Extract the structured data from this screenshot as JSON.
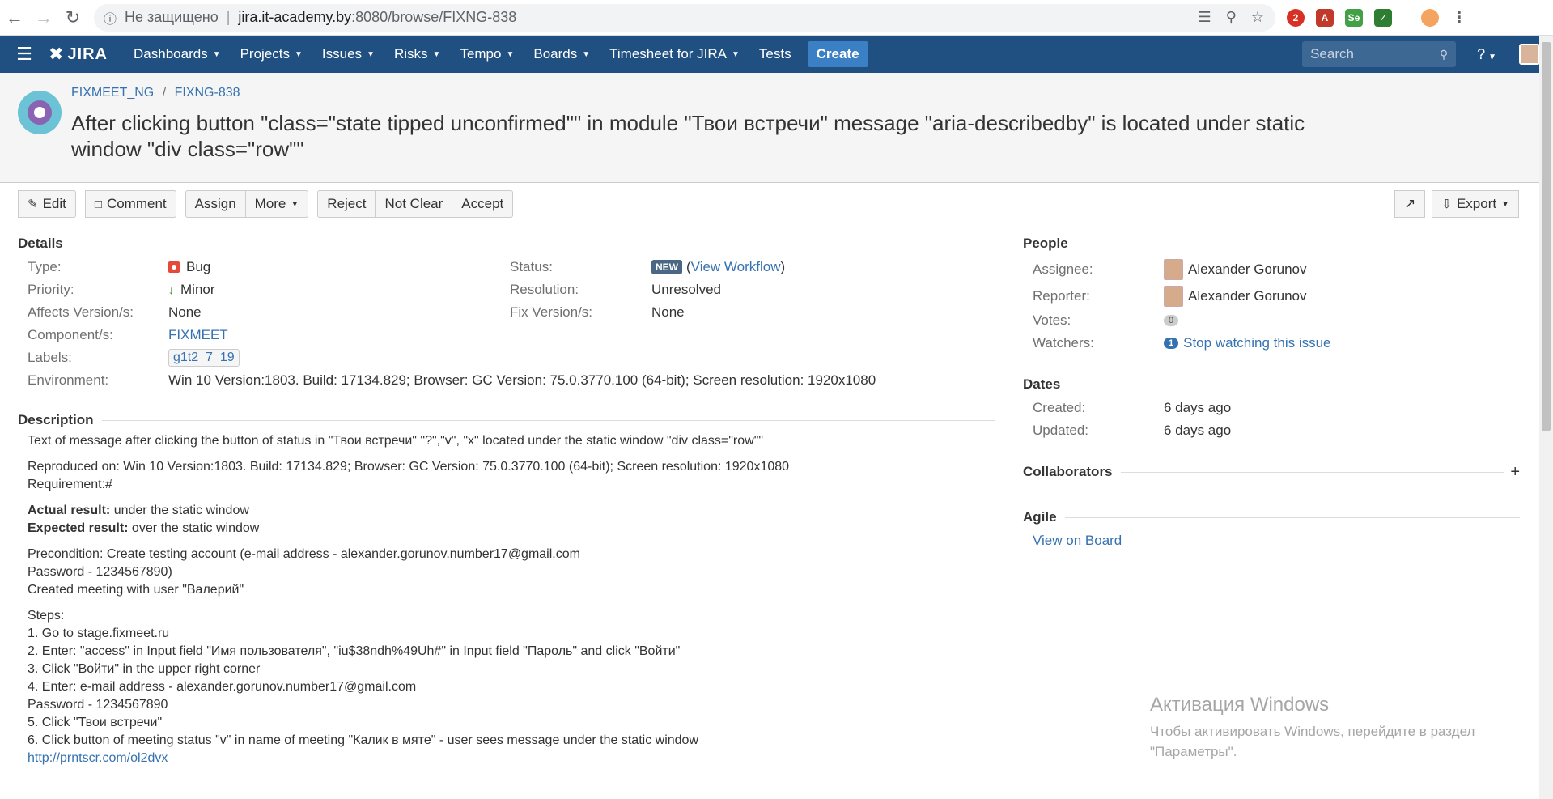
{
  "browser": {
    "not_secure": "Не защищено",
    "url_host": "jira.it-academy.by",
    "url_rest": ":8080/browse/FIXNG-838"
  },
  "header": {
    "logo": "JIRA",
    "nav": [
      "Dashboards",
      "Projects",
      "Issues",
      "Risks",
      "Tempo",
      "Boards",
      "Timesheet for JIRA"
    ],
    "tests": "Tests",
    "create": "Create",
    "search_placeholder": "Search",
    "help": "?"
  },
  "issue": {
    "project": "FIXMEET_NG",
    "key": "FIXNG-838",
    "summary": "After clicking button \"class=\"state tipped unconfirmed\"\" in module \"Твои встречи\" message \"aria-describedby\" is located under static window \"div class=\"row\"\""
  },
  "ops": {
    "edit": "Edit",
    "comment": "Comment",
    "assign": "Assign",
    "more": "More",
    "reject": "Reject",
    "not_clear": "Not Clear",
    "accept": "Accept",
    "export": "Export"
  },
  "details": {
    "title": "Details",
    "type_label": "Type:",
    "type": "Bug",
    "priority_label": "Priority:",
    "priority": "Minor",
    "affects_label": "Affects Version/s:",
    "affects": "None",
    "component_label": "Component/s:",
    "component": "FIXMEET",
    "labels_label": "Labels:",
    "labels": "g1t2_7_19",
    "environment_label": "Environment:",
    "environment": "Win 10 Version:1803. Build: 17134.829; Browser: GC Version: 75.0.3770.100 (64-bit); Screen resolution: 1920x1080",
    "status_label": "Status:",
    "status": "NEW",
    "view_workflow": "View Workflow",
    "resolution_label": "Resolution:",
    "resolution": "Unresolved",
    "fix_label": "Fix Version/s:",
    "fix": "None"
  },
  "description": {
    "title": "Description",
    "line1": "Text of message after clicking the button of status in \"Твои встречи\" \"?\",\"v\", \"x\" located under the static window \"div class=\"row\"\"",
    "reproduced": "Reproduced on: Win 10 Version:1803. Build: 17134.829; Browser: GC Version: 75.0.3770.100 (64-bit); Screen resolution: 1920x1080",
    "requirement": "Requirement:#",
    "actual_label": "Actual result:",
    "actual": " under the static window",
    "expected_label": "Expected result:",
    "expected": " over the static window",
    "pre1": "Precondition: Create testing account (e-mail address - alexander.gorunov.number17@gmail.com",
    "pre2": "Password - 1234567890)",
    "pre3": "Created meeting with user \"Валерий\"",
    "steps_title": "Steps:",
    "s1": "1. Go to stage.fixmeet.ru",
    "s2": "2. Enter: \"access\" in Input field \"Имя пользователя\", \"iu$38ndh%49Uh#\" in Input field \"Пароль\" and click \"Войти\"",
    "s3": "3. Click \"Войти\" in the upper right corner",
    "s4": "4. Enter: e-mail address - alexander.gorunov.number17@gmail.com",
    "s4b": "Password - 1234567890",
    "s5": "5. Click \"Твои встречи\"",
    "s6": "6. Click button of meeting status \"v\" in name of meeting \"Калик в мяте\" - user sees message under the static window",
    "link": "http://prntscr.com/ol2dvx"
  },
  "people": {
    "title": "People",
    "assignee_label": "Assignee:",
    "assignee": "Alexander Gorunov",
    "reporter_label": "Reporter:",
    "reporter": "Alexander Gorunov",
    "votes_label": "Votes:",
    "votes": "0",
    "watchers_label": "Watchers:",
    "watchers_count": "1",
    "watch_link": "Stop watching this issue"
  },
  "dates": {
    "title": "Dates",
    "created_label": "Created:",
    "created": "6 days ago",
    "updated_label": "Updated:",
    "updated": "6 days ago"
  },
  "collaborators": {
    "title": "Collaborators"
  },
  "agile": {
    "title": "Agile",
    "link": "View on Board"
  },
  "watermark": {
    "line1": "Активация Windows",
    "line2": "Чтобы активировать Windows, перейдите в раздел",
    "line3": "\"Параметры\"."
  }
}
